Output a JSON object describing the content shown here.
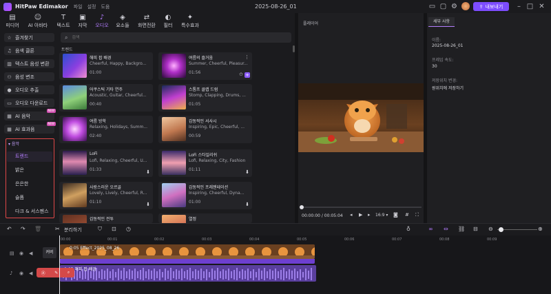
{
  "titlebar": {
    "app_name": "HitPaw Edimakor",
    "menus": [
      "파일",
      "설정",
      "도움"
    ],
    "doc_title": "2025-08-26_01",
    "export_label": "내보내기"
  },
  "tools": [
    {
      "label": "미디어",
      "icon": "media-icon"
    },
    {
      "label": "AI 아바타",
      "icon": "avatar-icon"
    },
    {
      "label": "텍스트",
      "icon": "text-icon"
    },
    {
      "label": "자막",
      "icon": "subtitle-icon"
    },
    {
      "label": "오디오",
      "icon": "audio-icon",
      "active": true
    },
    {
      "label": "요소들",
      "icon": "elements-icon"
    },
    {
      "label": "화면전환",
      "icon": "transition-icon"
    },
    {
      "label": "필터",
      "icon": "filter-icon"
    },
    {
      "label": "특수효과",
      "icon": "effects-icon"
    }
  ],
  "leftnav": {
    "items": [
      {
        "label": "즐겨찾기",
        "icon": "star-icon"
      },
      {
        "label": "음색 클론",
        "icon": "clone-icon"
      },
      {
        "label": "텍스트 음성 변환",
        "icon": "tts-icon"
      },
      {
        "label": "음성 변조",
        "icon": "voice-change-icon"
      },
      {
        "label": "오디오 추출",
        "icon": "mic-icon"
      },
      {
        "label": "오디오 다운로드",
        "icon": "download-icon"
      },
      {
        "label": "AI 음악",
        "icon": "ai-music-icon",
        "badge": "NEW"
      },
      {
        "label": "AI 효과음",
        "icon": "ai-sfx-icon",
        "badge": "NEW"
      }
    ],
    "music_header": "음악",
    "music_categories": [
      "트렌드",
      "밝은",
      "은은한",
      "슬픔",
      "다크 & 서스펜스"
    ]
  },
  "library": {
    "search_placeholder": "검색",
    "section": "트렌드",
    "cards": [
      {
        "title": "해피 팝 배경",
        "tags": "Cheerful, Happy, Backgro...",
        "duration": "01:00"
      },
      {
        "title": "여름의 즐거움",
        "tags": "Summer, Cheerful, Pleasur...",
        "duration": "01:56"
      },
      {
        "title": "어쿠스틱 기타 연주",
        "tags": "Acoustic, Guitar, Cheerful...",
        "duration": "00:40"
      },
      {
        "title": "스톰프 클랩 드럼",
        "tags": "Stomp, Clapping, Drums, ...",
        "duration": "01:05"
      },
      {
        "title": "여름 방학",
        "tags": "Relaxing, Holidays, Summ...",
        "duration": "02:40"
      },
      {
        "title": "감동적인 서사시",
        "tags": "Inspiring, Epic, Cheerful, ...",
        "duration": "00:59"
      },
      {
        "title": "LoFi",
        "tags": "Lofi, Relaxing, Cheerful, U...",
        "duration": "01:33"
      },
      {
        "title": "LoFi 스타일리쉬",
        "tags": "Lofi, Relaxing, City, Fashion",
        "duration": "01:11"
      },
      {
        "title": "사랑스러운 오르골",
        "tags": "Lovely, Lively, Cheerful, R...",
        "duration": "01:10"
      },
      {
        "title": "감동적인 프레젠테이션",
        "tags": "Inspiring, Cheerful, Dyna...",
        "duration": "01:00"
      },
      {
        "title": "감동적인 전투",
        "tags": "",
        "duration": ""
      },
      {
        "title": "열정",
        "tags": "",
        "duration": ""
      }
    ]
  },
  "player": {
    "header": "플레이어",
    "time_current": "00:00:00",
    "time_total": "00:05:04",
    "ratio": "16:9"
  },
  "details": {
    "tab": "세부 사항",
    "name_label": "이름:",
    "name_value": "2025-08-26_01",
    "fps_label": "프레임 속도:",
    "fps_value": "30",
    "save_label": "저장위치 변경:",
    "save_value": "원위치에 저장하기"
  },
  "timeline": {
    "split_label": "분리하기",
    "ruler": [
      "00:00",
      "00:01",
      "00:02",
      "00:03",
      "00:04",
      "00:05",
      "00:06",
      "00:07",
      "00:08",
      "00:09"
    ],
    "cover_label": "커버",
    "video_clip": "0:05 Effect_2025_08_26",
    "audio_clip": "0:05 해피 팝 배경"
  }
}
